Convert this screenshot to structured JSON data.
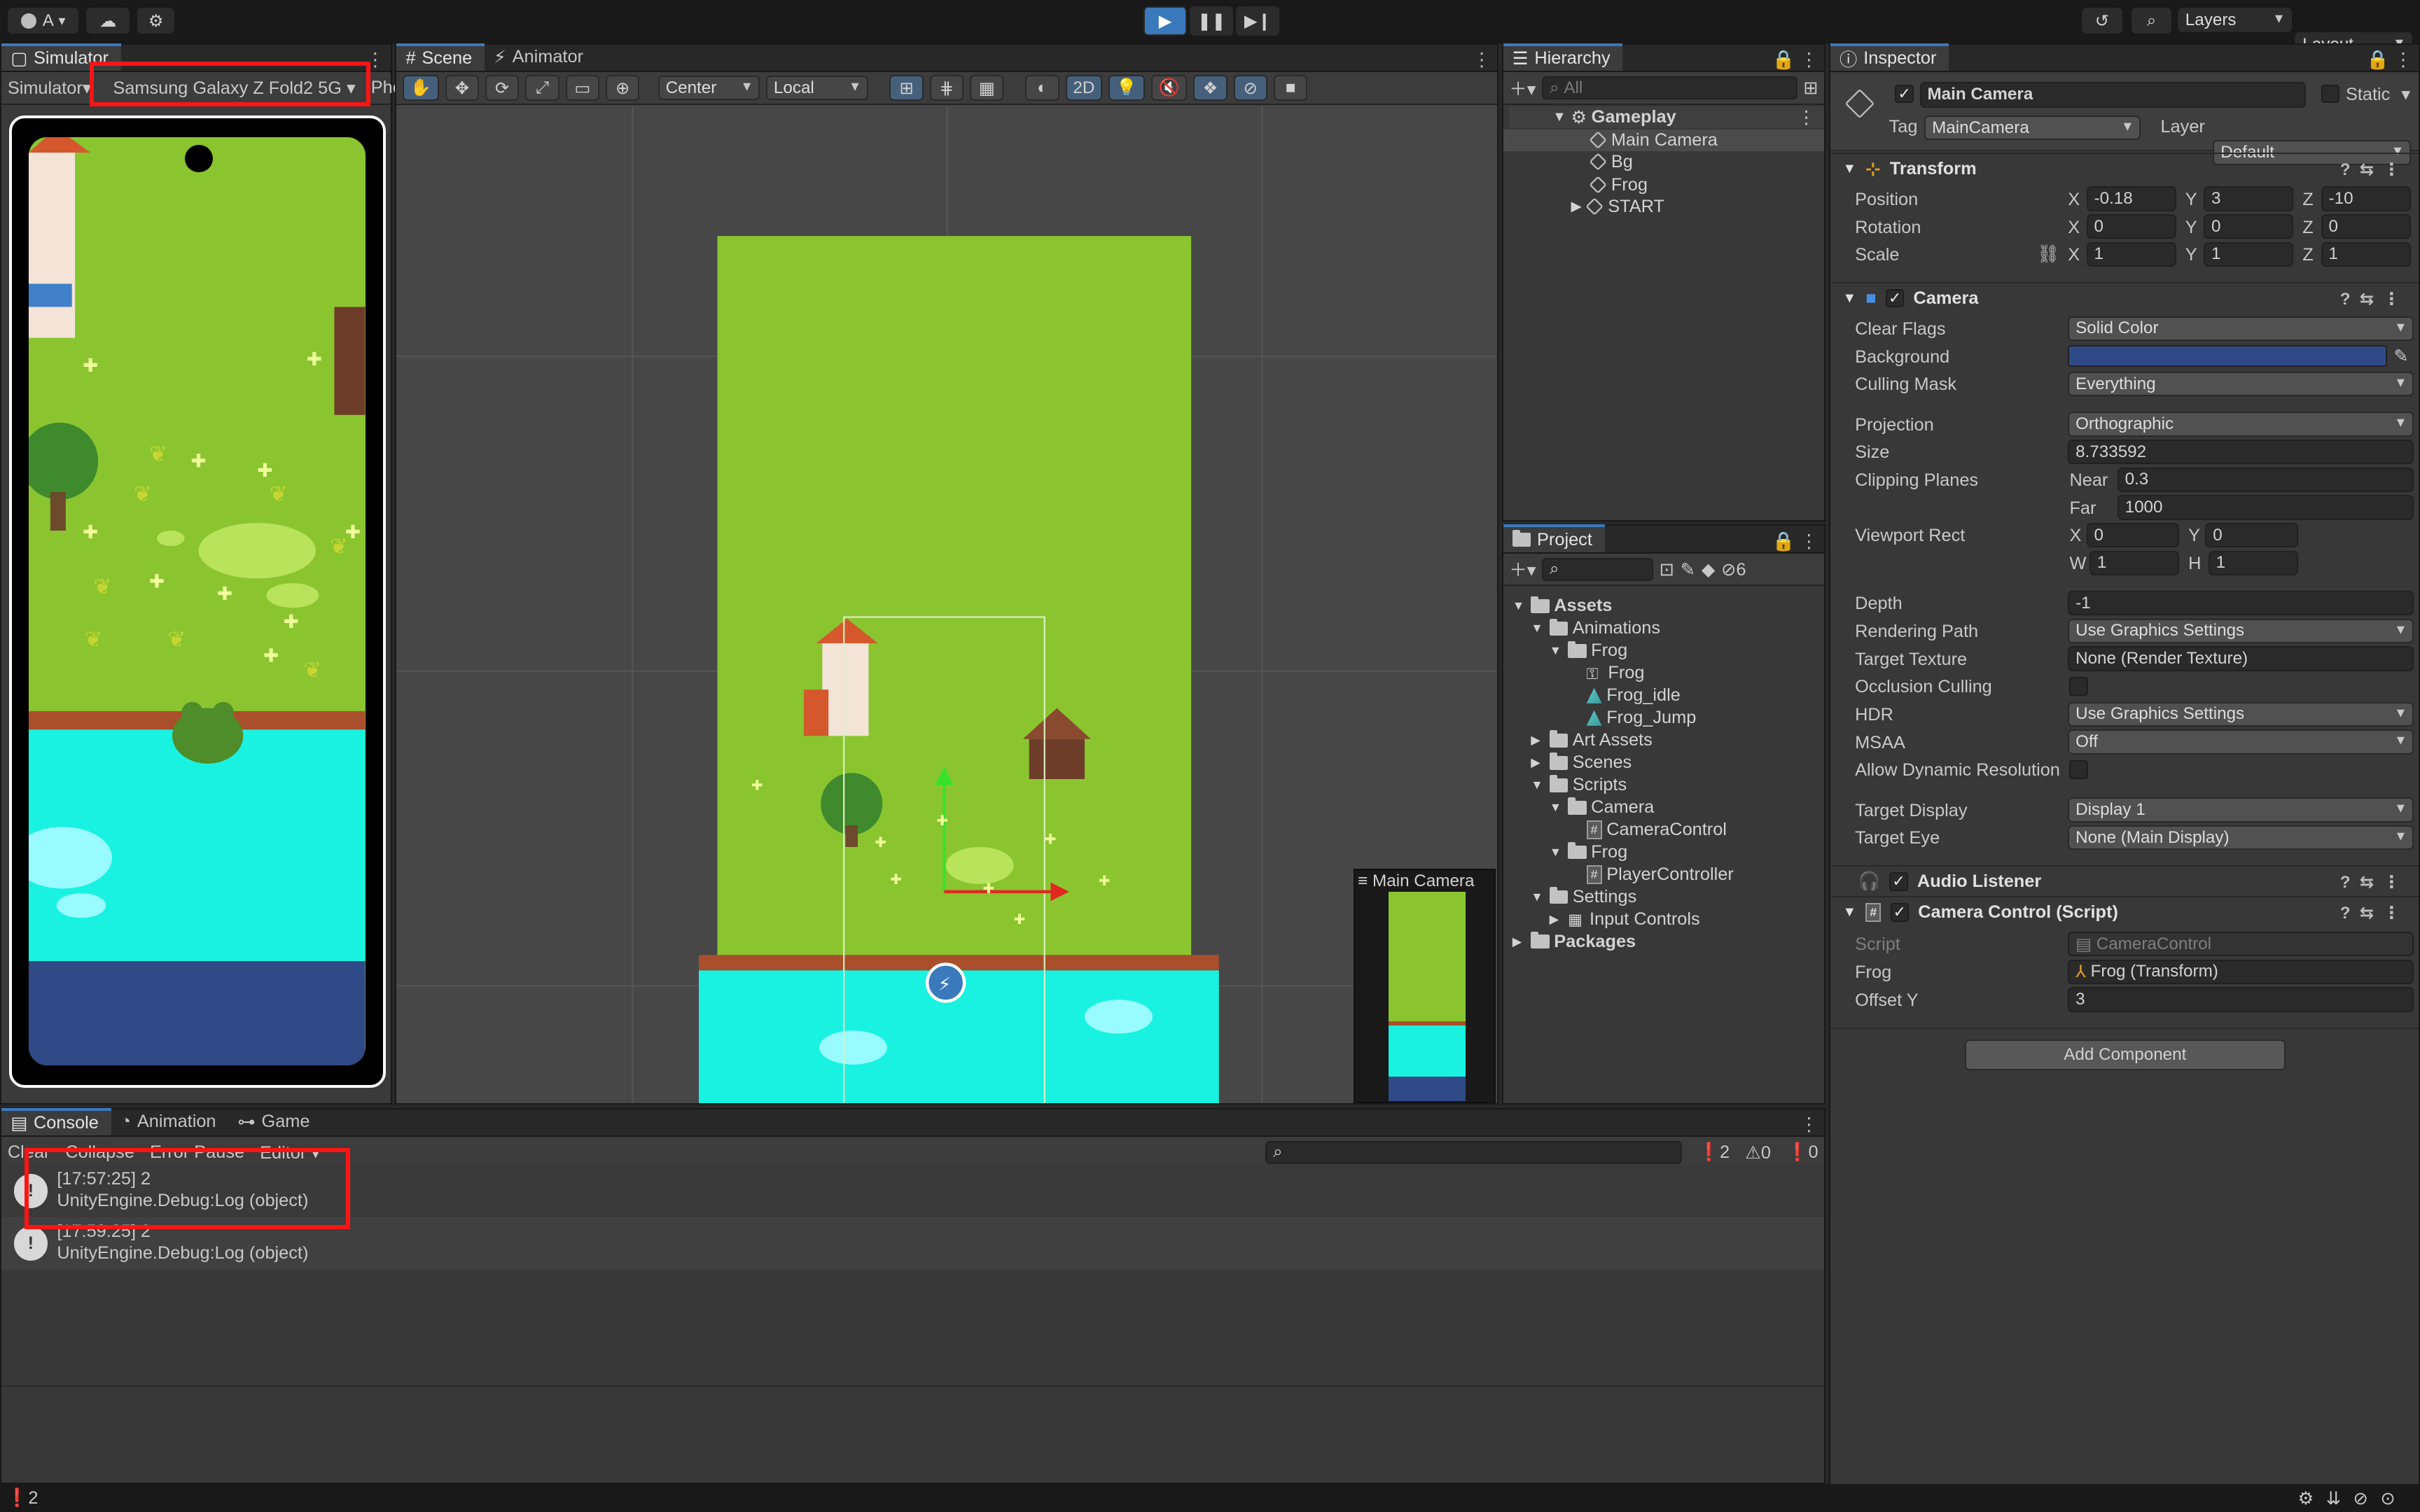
{
  "topbar": {
    "account_label": "A",
    "layers_label": "Layers",
    "layout_label": "Layout"
  },
  "simulator": {
    "tab_label": "Simulator",
    "mode_label": "Simulator",
    "device_label": "Samsung Galaxy Z Fold2 5G",
    "extra_label": "Phor"
  },
  "scene": {
    "tabs": [
      {
        "label": "Scene"
      },
      {
        "label": "Animator"
      }
    ],
    "pivot_label": "Center",
    "space_label": "Local",
    "mode2d_label": "2D",
    "camera_preview_label": "Main Camera"
  },
  "hierarchy": {
    "tab_label": "Hierarchy",
    "search_placeholder": "All",
    "scene_name": "Gameplay",
    "items": [
      {
        "label": "Main Camera"
      },
      {
        "label": "Bg"
      },
      {
        "label": "Frog"
      },
      {
        "label": "START"
      }
    ]
  },
  "project": {
    "tab_label": "Project",
    "hidden_count": "6",
    "tree": [
      {
        "label": "Assets"
      },
      {
        "label": "Animations"
      },
      {
        "label": "Frog"
      },
      {
        "label": "Frog"
      },
      {
        "label": "Frog_idle"
      },
      {
        "label": "Frog_Jump"
      },
      {
        "label": "Art Assets"
      },
      {
        "label": "Scenes"
      },
      {
        "label": "Scripts"
      },
      {
        "label": "Camera"
      },
      {
        "label": "CameraControl"
      },
      {
        "label": "Frog"
      },
      {
        "label": "PlayerController"
      },
      {
        "label": "Settings"
      },
      {
        "label": "Input Controls"
      },
      {
        "label": "Packages"
      }
    ]
  },
  "inspector": {
    "tab_label": "Inspector",
    "object_name": "Main Camera",
    "static_label": "Static",
    "tag_label": "Tag",
    "tag_value": "MainCamera",
    "layer_label": "Layer",
    "layer_value": "Default",
    "transform": {
      "title": "Transform",
      "position_label": "Position",
      "position": {
        "x": "-0.18",
        "y": "3",
        "z": "-10"
      },
      "rotation_label": "Rotation",
      "rotation": {
        "x": "0",
        "y": "0",
        "z": "0"
      },
      "scale_label": "Scale",
      "scale": {
        "x": "1",
        "y": "1",
        "z": "1"
      }
    },
    "axis": {
      "x": "X",
      "y": "Y",
      "z": "Z",
      "w": "W",
      "h": "H"
    },
    "camera": {
      "title": "Camera",
      "clear_flags_label": "Clear Flags",
      "clear_flags": "Solid Color",
      "background_label": "Background",
      "background_color": "#2f4a86",
      "culling_mask_label": "Culling Mask",
      "culling_mask": "Everything",
      "projection_label": "Projection",
      "projection": "Orthographic",
      "size_label": "Size",
      "size": "8.733592",
      "clipping_label": "Clipping Planes",
      "near_label": "Near",
      "near": "0.3",
      "far_label": "Far",
      "far": "1000",
      "viewport_label": "Viewport Rect",
      "vx": "0",
      "vy": "0",
      "vw": "1",
      "vh": "1",
      "depth_label": "Depth",
      "depth": "-1",
      "rendering_path_label": "Rendering Path",
      "rendering_path": "Use Graphics Settings",
      "target_texture_label": "Target Texture",
      "target_texture": "None (Render Texture)",
      "occlusion_label": "Occlusion Culling",
      "hdr_label": "HDR",
      "hdr": "Use Graphics Settings",
      "msaa_label": "MSAA",
      "msaa": "Off",
      "dynres_label": "Allow Dynamic Resolution",
      "target_display_label": "Target Display",
      "target_display": "Display 1",
      "target_eye_label": "Target Eye",
      "target_eye": "None (Main Display)"
    },
    "audio_listener_title": "Audio Listener",
    "camera_control": {
      "title": "Camera Control (Script)",
      "script_label": "Script",
      "script": "CameraControl",
      "frog_label": "Frog",
      "frog": "Frog (Transform)",
      "offset_label": "Offset Y",
      "offset": "3"
    },
    "add_component_label": "Add Component"
  },
  "console": {
    "tabs": [
      {
        "label": "Console"
      },
      {
        "label": "Animation"
      },
      {
        "label": "Game"
      }
    ],
    "toolbar": {
      "clear": "Clear",
      "collapse": "Collapse",
      "error_pause": "Error Pause",
      "editor": "Editor"
    },
    "counts": {
      "info": "2",
      "warn": "0",
      "error": "0"
    },
    "logs": [
      {
        "time": "[17:57:25] 2",
        "message": "UnityEngine.Debug:Log (object)"
      },
      {
        "time": "[17:59:25] 2",
        "message": "UnityEngine.Debug:Log (object)"
      }
    ]
  },
  "statusbar": {
    "count": "2"
  },
  "colors": {
    "accent": "#3a79bb",
    "highlight": "#ff1414",
    "grass": "#8ac530",
    "water": "#19f2e1",
    "deep_water": "#2f4a86"
  }
}
